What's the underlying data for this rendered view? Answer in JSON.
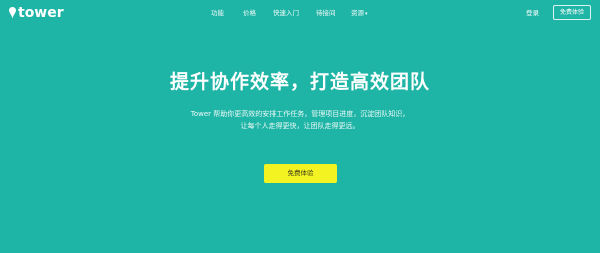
{
  "brand": {
    "name": "tower",
    "icon": "pin-logo-icon"
  },
  "nav": {
    "items": [
      {
        "label": "功能"
      },
      {
        "label": "价格"
      },
      {
        "label": "快速入门"
      },
      {
        "label": "待接间"
      },
      {
        "label": "资源",
        "has_dropdown": true,
        "caret": "▾"
      }
    ]
  },
  "header_actions": {
    "login_label": "登录",
    "trial_label": "免费体验"
  },
  "hero": {
    "title": "提升协作效率，打造高效团队",
    "subtitle_line1": "Tower 帮助你更高效的安排工作任务，管理项目进度，沉淀团队知识，",
    "subtitle_line2": "让每个人走得更快，让团队走得更远。",
    "cta_label": "免费体验"
  },
  "colors": {
    "background": "#1fb5a6",
    "cta_background": "#f3f321",
    "text": "#ffffff"
  }
}
